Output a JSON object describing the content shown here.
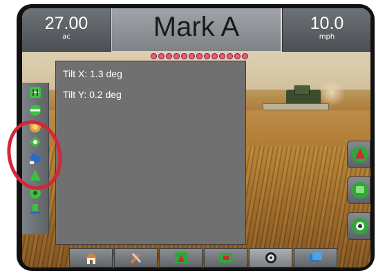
{
  "status_bar": {
    "area": {
      "value": "27.00",
      "unit": "ac"
    },
    "title": "Mark A",
    "speed": {
      "value": "10.0",
      "unit": "mph"
    },
    "lightbar_leds": 13
  },
  "info_panel": {
    "tilt_x": "Tilt X: 1.3 deg",
    "tilt_y": "Tilt Y: 0.2 deg"
  },
  "left_toolbar": {
    "items": [
      "guidance-mode-icon",
      "boundary-icon",
      "marker-icon",
      "tilt-sensor-icon",
      "nudge-icon",
      "vehicle-icon"
    ]
  },
  "right_toolbar": {
    "items": [
      "vehicle-view-icon",
      "map-view-icon",
      "screen-options-icon"
    ]
  },
  "bottom_nav": {
    "items": [
      "home-icon",
      "tools-icon",
      "vehicle-view-icon",
      "field-map-icon",
      "real-view-icon",
      "data-icon"
    ],
    "active_index": 4
  },
  "colors": {
    "accent_green": "#3fbf3f",
    "alert_red": "#d4263a",
    "led_pink": "#e6578a",
    "panel_gray": "#707070"
  }
}
